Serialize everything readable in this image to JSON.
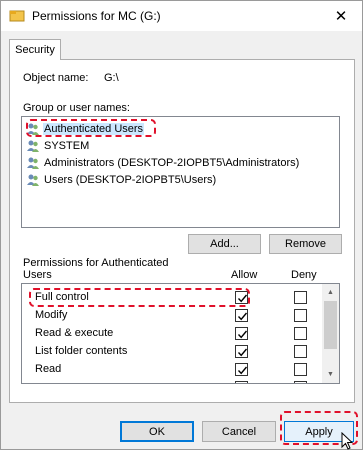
{
  "window": {
    "title": "Permissions for MC (G:)",
    "close_glyph": "✕"
  },
  "tabs": [
    {
      "label": "Security"
    }
  ],
  "object": {
    "label": "Object name:",
    "value": "G:\\"
  },
  "groups": {
    "label": "Group or user names:",
    "items": [
      {
        "name": "Authenticated Users",
        "icon": "users-icon",
        "selected": true
      },
      {
        "name": "SYSTEM",
        "icon": "users-icon"
      },
      {
        "name": "Administrators (DESKTOP-2IOPBT5\\Administrators)",
        "icon": "users-icon"
      },
      {
        "name": "Users (DESKTOP-2IOPBT5\\Users)",
        "icon": "users-icon"
      }
    ]
  },
  "buttons": {
    "add": "Add...",
    "remove": "Remove",
    "ok": "OK",
    "cancel": "Cancel",
    "apply": "Apply"
  },
  "permissions": {
    "label_line1": "Permissions for Authenticated",
    "label_line2": "Users",
    "allow_header": "Allow",
    "deny_header": "Deny",
    "rows": [
      {
        "name": "Full control",
        "allow": true,
        "deny": false
      },
      {
        "name": "Modify",
        "allow": true,
        "deny": false
      },
      {
        "name": "Read & execute",
        "allow": true,
        "deny": false
      },
      {
        "name": "List folder contents",
        "allow": true,
        "deny": false
      },
      {
        "name": "Read",
        "allow": true,
        "deny": false
      },
      {
        "name": "",
        "allow": false,
        "deny": false
      }
    ]
  },
  "colors": {
    "highlight": "#e0102a",
    "selection": "#cce8ff",
    "default_button_border": "#0078d7"
  }
}
